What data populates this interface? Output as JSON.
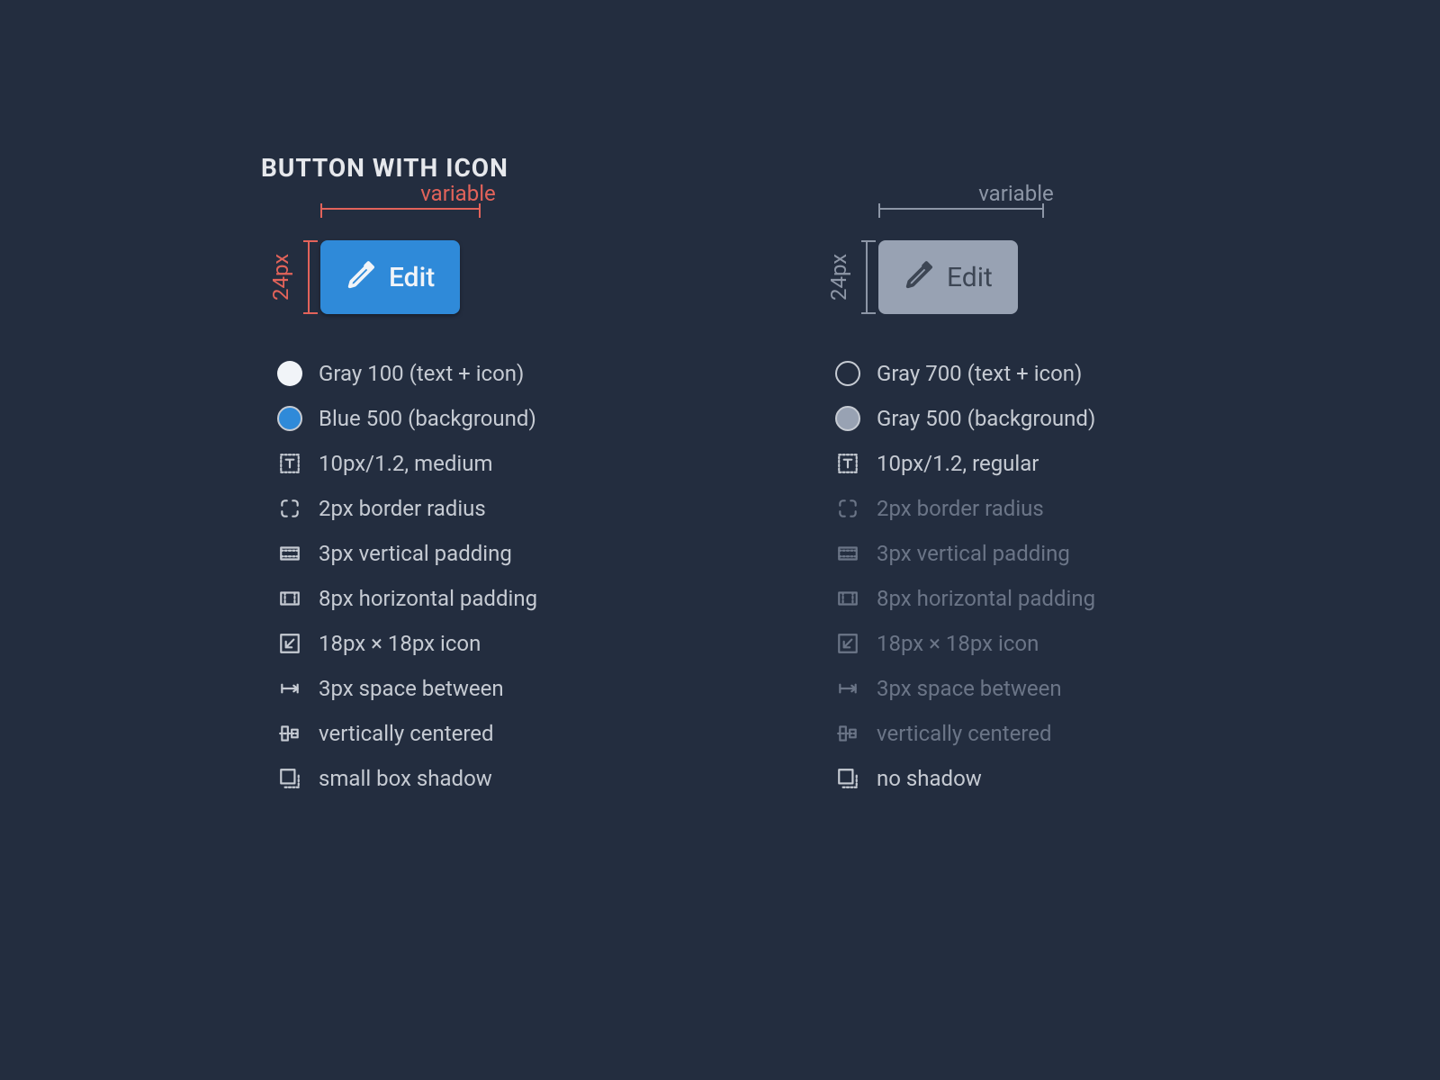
{
  "title": "BUTTON WITH ICON",
  "dimensions": {
    "width_label": "variable",
    "height_label": "24px"
  },
  "button_label": "Edit",
  "colors": {
    "gray100": "#f1f4f8",
    "blue500": "#2f8ad9",
    "gray700": "#3d4654",
    "gray500": "#98a2b3",
    "annotation_primary": "#e2635a",
    "annotation_disabled": "#8d96a6"
  },
  "primary": {
    "specs": [
      {
        "key": "text_color",
        "label": "Gray 100 (text + icon)"
      },
      {
        "key": "bg_color",
        "label": "Blue 500 (background)"
      },
      {
        "key": "typography",
        "label": "10px/1.2, medium"
      },
      {
        "key": "radius",
        "label": "2px border radius"
      },
      {
        "key": "vpad",
        "label": "3px vertical padding"
      },
      {
        "key": "hpad",
        "label": "8px horizontal padding"
      },
      {
        "key": "icon_size",
        "label": "18px × 18px icon"
      },
      {
        "key": "gap",
        "label": "3px space between"
      },
      {
        "key": "align",
        "label": "vertically centered"
      },
      {
        "key": "shadow",
        "label": "small box shadow"
      }
    ]
  },
  "disabled": {
    "specs": [
      {
        "key": "text_color",
        "label": "Gray 700 (text + icon)"
      },
      {
        "key": "bg_color",
        "label": "Gray 500 (background)"
      },
      {
        "key": "typography",
        "label": "10px/1.2, regular"
      },
      {
        "key": "radius",
        "label": "2px border radius"
      },
      {
        "key": "vpad",
        "label": "3px vertical padding"
      },
      {
        "key": "hpad",
        "label": "8px horizontal padding"
      },
      {
        "key": "icon_size",
        "label": "18px × 18px icon"
      },
      {
        "key": "gap",
        "label": "3px space between"
      },
      {
        "key": "align",
        "label": "vertically centered"
      },
      {
        "key": "shadow",
        "label": "no shadow"
      }
    ]
  }
}
